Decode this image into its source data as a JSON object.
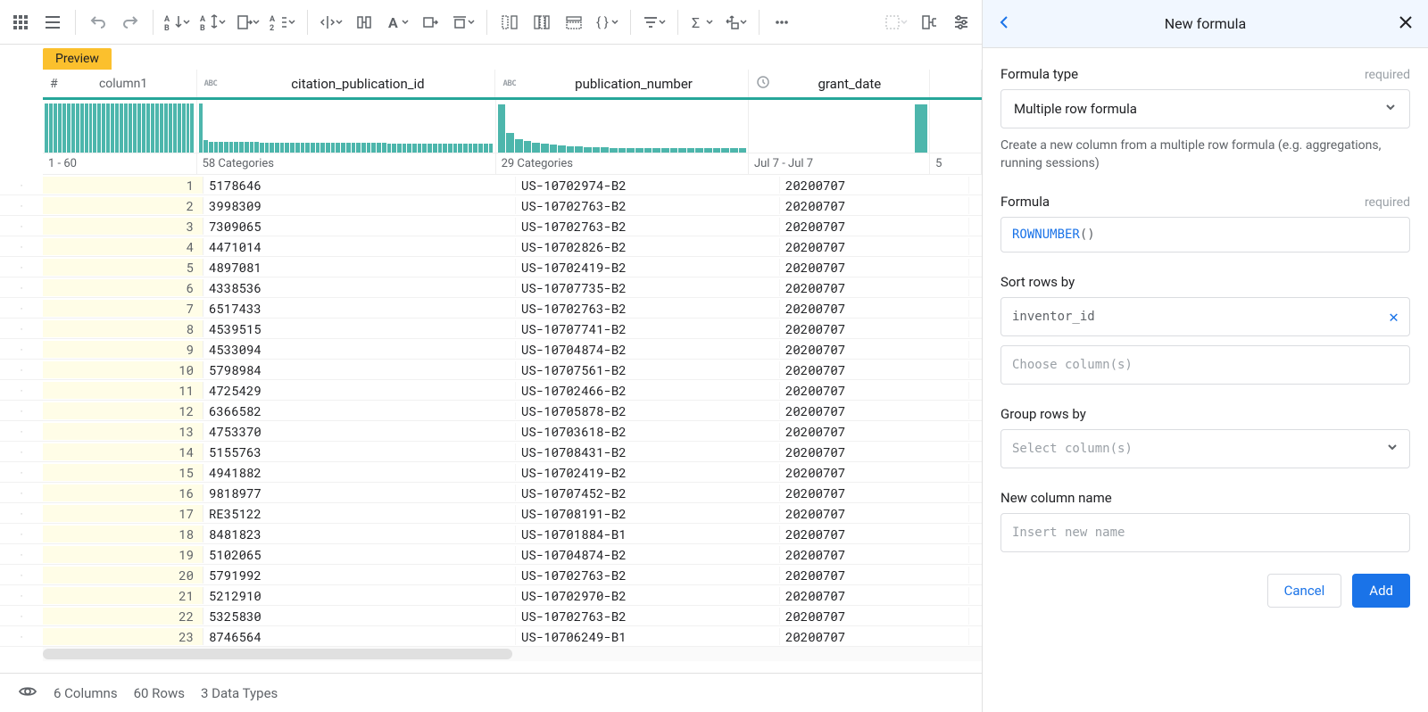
{
  "preview_label": "Preview",
  "columns": {
    "rownum": {
      "name": "column1",
      "range": "1 - 60"
    },
    "citation": {
      "name": "citation_publication_id",
      "type_badge": "ABC",
      "summary": "58 Categories"
    },
    "publication": {
      "name": "publication_number",
      "type_badge": "ABC",
      "summary": "29 Categories"
    },
    "grant_date": {
      "name": "grant_date",
      "summary": "Jul 7 - Jul 7"
    },
    "last_col_summary": "5"
  },
  "rows": [
    {
      "n": "1",
      "cit": "5178646",
      "pub": "US-10702974-B2",
      "dt": "20200707"
    },
    {
      "n": "2",
      "cit": "3998309",
      "pub": "US-10702763-B2",
      "dt": "20200707"
    },
    {
      "n": "3",
      "cit": "7309065",
      "pub": "US-10702763-B2",
      "dt": "20200707"
    },
    {
      "n": "4",
      "cit": "4471014",
      "pub": "US-10702826-B2",
      "dt": "20200707"
    },
    {
      "n": "5",
      "cit": "4897081",
      "pub": "US-10702419-B2",
      "dt": "20200707"
    },
    {
      "n": "6",
      "cit": "4338536",
      "pub": "US-10707735-B2",
      "dt": "20200707"
    },
    {
      "n": "7",
      "cit": "6517433",
      "pub": "US-10702763-B2",
      "dt": "20200707"
    },
    {
      "n": "8",
      "cit": "4539515",
      "pub": "US-10707741-B2",
      "dt": "20200707"
    },
    {
      "n": "9",
      "cit": "4533094",
      "pub": "US-10704874-B2",
      "dt": "20200707"
    },
    {
      "n": "10",
      "cit": "5798984",
      "pub": "US-10707561-B2",
      "dt": "20200707"
    },
    {
      "n": "11",
      "cit": "4725429",
      "pub": "US-10702466-B2",
      "dt": "20200707"
    },
    {
      "n": "12",
      "cit": "6366582",
      "pub": "US-10705878-B2",
      "dt": "20200707"
    },
    {
      "n": "13",
      "cit": "4753370",
      "pub": "US-10703618-B2",
      "dt": "20200707"
    },
    {
      "n": "14",
      "cit": "5155763",
      "pub": "US-10708431-B2",
      "dt": "20200707"
    },
    {
      "n": "15",
      "cit": "4941882",
      "pub": "US-10702419-B2",
      "dt": "20200707"
    },
    {
      "n": "16",
      "cit": "9818977",
      "pub": "US-10707452-B2",
      "dt": "20200707"
    },
    {
      "n": "17",
      "cit": "RE35122",
      "pub": "US-10708191-B2",
      "dt": "20200707"
    },
    {
      "n": "18",
      "cit": "8481823",
      "pub": "US-10701884-B1",
      "dt": "20200707"
    },
    {
      "n": "19",
      "cit": "5102065",
      "pub": "US-10704874-B2",
      "dt": "20200707"
    },
    {
      "n": "20",
      "cit": "5791992",
      "pub": "US-10702763-B2",
      "dt": "20200707"
    },
    {
      "n": "21",
      "cit": "5212910",
      "pub": "US-10702970-B2",
      "dt": "20200707"
    },
    {
      "n": "22",
      "cit": "5325830",
      "pub": "US-10702763-B2",
      "dt": "20200707"
    },
    {
      "n": "23",
      "cit": "8746564",
      "pub": "US-10706249-B1",
      "dt": "20200707"
    }
  ],
  "status": {
    "columns": "6 Columns",
    "rows": "60 Rows",
    "types": "3 Data Types"
  },
  "panel": {
    "title": "New formula",
    "formula_type_label": "Formula type",
    "required": "required",
    "formula_type_value": "Multiple row formula",
    "formula_type_desc": "Create a new column from a multiple row formula (e.g. aggregations, running sessions)",
    "formula_label": "Formula",
    "formula_fn": "ROWNUMBER",
    "formula_paren": "()",
    "sort_label": "Sort rows by",
    "sort_value": "inventor_id",
    "sort_placeholder": "Choose column(s)",
    "group_label": "Group rows by",
    "group_placeholder": "Select column(s)",
    "newcol_label": "New column name",
    "newcol_placeholder": "Insert new name",
    "cancel": "Cancel",
    "add": "Add"
  },
  "hist": {
    "rn": [
      55,
      55,
      55,
      55,
      55,
      55,
      55,
      55,
      55,
      55,
      55,
      55,
      55,
      55,
      55,
      55,
      55,
      55,
      55,
      55,
      55,
      55,
      55,
      55,
      55,
      55,
      55,
      55,
      55,
      55,
      55,
      55,
      55,
      55
    ],
    "cit": [
      55,
      14,
      12,
      12,
      12,
      12,
      12,
      12,
      12,
      12,
      12,
      12,
      11,
      11,
      11,
      11,
      11,
      11,
      11,
      11,
      11,
      11,
      11,
      11,
      11,
      11,
      11,
      11,
      11,
      11,
      11,
      11,
      11,
      11,
      11,
      11,
      11,
      10,
      10,
      10,
      10,
      10,
      10,
      10,
      10,
      10,
      10,
      10,
      10,
      10,
      10,
      10,
      10,
      10,
      10,
      10,
      10,
      10
    ],
    "pub": [
      54,
      22,
      15,
      13,
      11,
      10,
      9,
      8,
      7,
      7,
      6,
      6,
      6,
      5,
      5,
      5,
      5,
      5,
      5,
      5,
      5,
      5,
      5,
      5,
      5,
      5,
      5,
      5,
      5
    ],
    "dt_big": 54
  }
}
